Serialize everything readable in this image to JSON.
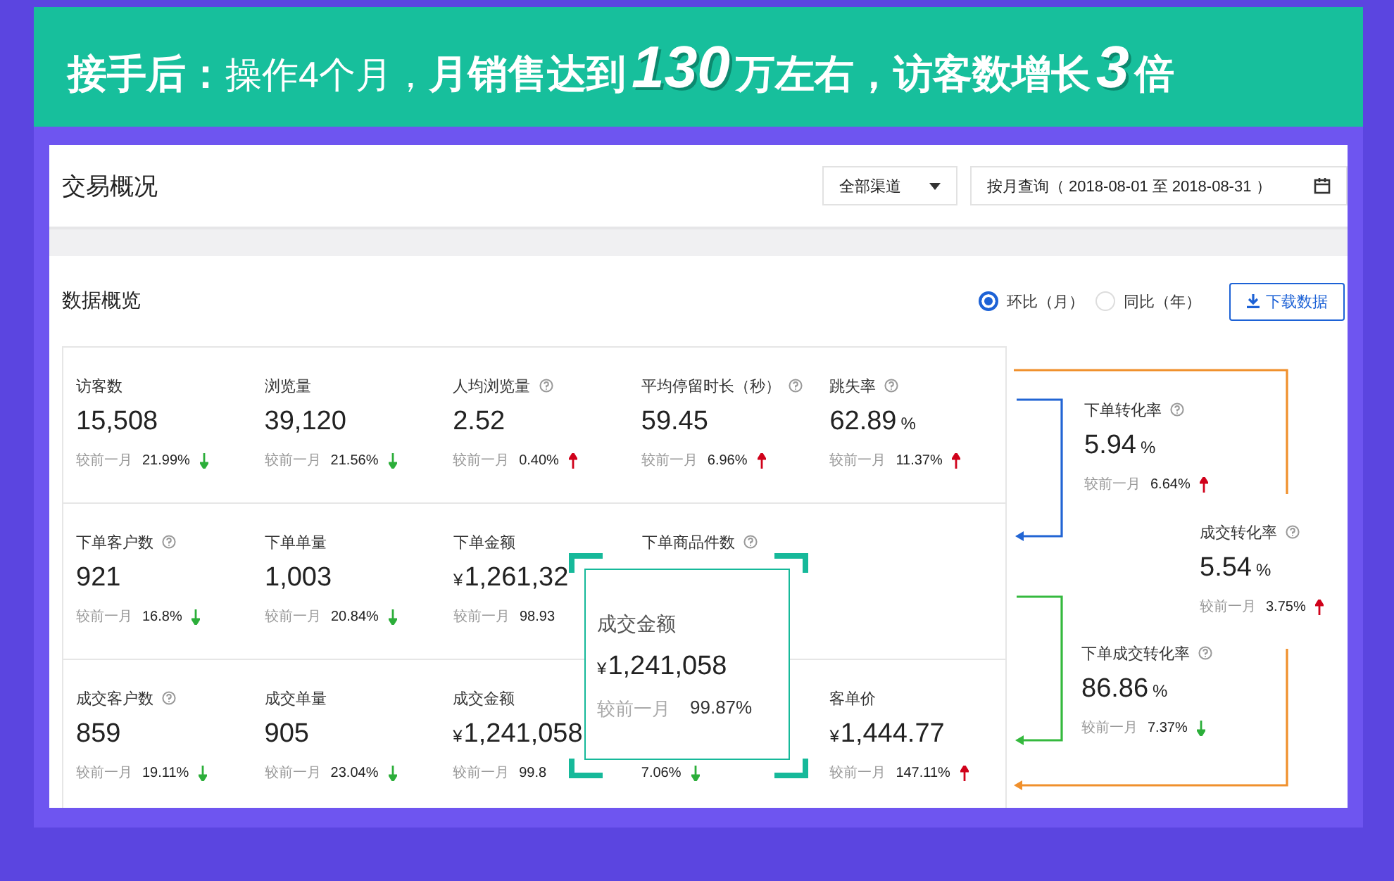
{
  "banner": {
    "segments": [
      {
        "kind": "bold",
        "text": "接手后："
      },
      {
        "kind": "light",
        "text": "操作4个月，"
      },
      {
        "kind": "bold",
        "text": "月销售达到"
      },
      {
        "kind": "big",
        "text": "130"
      },
      {
        "kind": "bold",
        "text": "万左右，访客数增长"
      },
      {
        "kind": "big",
        "text": "3"
      },
      {
        "kind": "bold",
        "text": "倍"
      }
    ]
  },
  "header": {
    "title": "交易概况",
    "channel": "全部渠道",
    "date_range": "按月查询（ 2018-08-01 至 2018-08-31 ）"
  },
  "overview": {
    "title": "数据概览",
    "options": [
      {
        "label": "环比（月）",
        "selected": true
      },
      {
        "label": "同比（年）",
        "selected": false
      }
    ],
    "download": "下载数据"
  },
  "rows": [
    [
      {
        "label": "访客数",
        "help": false,
        "value": "15,508",
        "compare_label": "较前一月",
        "compare": "21.99%",
        "increase": false
      },
      {
        "label": "浏览量",
        "help": false,
        "value": "39,120",
        "compare_label": "较前一月",
        "compare": "21.56%",
        "increase": false
      },
      {
        "label": "人均浏览量",
        "help": true,
        "value": "2.52",
        "compare_label": "较前一月",
        "compare": "0.40%",
        "increase": true
      },
      {
        "label": "平均停留时长（秒）",
        "help": true,
        "value": "59.45",
        "compare_label": "较前一月",
        "compare": "6.96%",
        "increase": true
      },
      {
        "label": "跳失率",
        "help": true,
        "value": "62.89",
        "unit": "%",
        "compare_label": "较前一月",
        "compare": "11.37%",
        "increase": true
      }
    ],
    [
      {
        "label": "下单客户数",
        "help": true,
        "value": "921",
        "compare_label": "较前一月",
        "compare": "16.8%",
        "increase": false
      },
      {
        "label": "下单单量",
        "help": false,
        "value": "1,003",
        "compare_label": "较前一月",
        "compare": "20.84%",
        "increase": false
      },
      {
        "label": "下单金额",
        "help": false,
        "currency": "¥",
        "value": "1,261,32",
        "compare_label": "较前一月",
        "compare": "98.93"
      },
      {
        "label": "下单商品件数",
        "help": true
      }
    ],
    [
      {
        "label": "成交客户数",
        "help": true,
        "value": "859",
        "compare_label": "较前一月",
        "compare": "19.11%",
        "increase": false
      },
      {
        "label": "成交单量",
        "help": false,
        "value": "905",
        "compare_label": "较前一月",
        "compare": "23.04%",
        "increase": false
      },
      {
        "label": "成交金额",
        "help": false,
        "currency": "¥",
        "value": "1,241,058",
        "compare_label": "较前一月",
        "compare": "99.8"
      },
      {
        "compare": "7.06%",
        "increase": false
      },
      {
        "label": "客单价",
        "help": false,
        "currency": "¥",
        "value": "1,444.77",
        "compare_label": "较前一月",
        "compare": "147.11%",
        "increase": true
      }
    ]
  ],
  "popup": {
    "label": "成交金额",
    "currency": "¥",
    "value": "1,241,058",
    "compare_label": "较前一月",
    "compare": "99.87%"
  },
  "funnel": [
    {
      "label": "下单转化率",
      "value": "5.94",
      "unit": "%",
      "compare_label": "较前一月",
      "compare": "6.64%",
      "increase": true
    },
    {
      "label": "成交转化率",
      "value": "5.54",
      "unit": "%",
      "compare_label": "较前一月",
      "compare": "3.75%",
      "increase": true
    },
    {
      "label": "下单成交转化率",
      "value": "86.86",
      "unit": "%",
      "compare_label": "较前一月",
      "compare": "7.37%",
      "increase": false
    }
  ]
}
